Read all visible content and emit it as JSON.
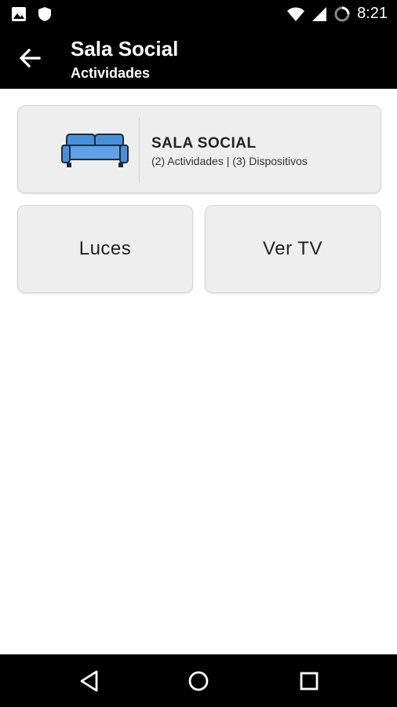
{
  "status_bar": {
    "time": "8:21",
    "icons": [
      "image-icon",
      "shield-icon",
      "wifi-icon",
      "signal-icon",
      "battery-icon"
    ]
  },
  "toolbar": {
    "title": "Sala Social",
    "subtitle": "Actividades",
    "back_icon": "arrow-left-icon"
  },
  "room": {
    "name": "SALA SOCIAL",
    "info": "(2) Actividades | (3) Dispositivos",
    "icon": "sofa-icon",
    "icon_color": "#4a90d9"
  },
  "activities": [
    {
      "label": "Luces"
    },
    {
      "label": "Ver TV"
    }
  ],
  "navigation": {
    "buttons": [
      "back-triangle-icon",
      "home-circle-icon",
      "recents-square-icon"
    ]
  }
}
